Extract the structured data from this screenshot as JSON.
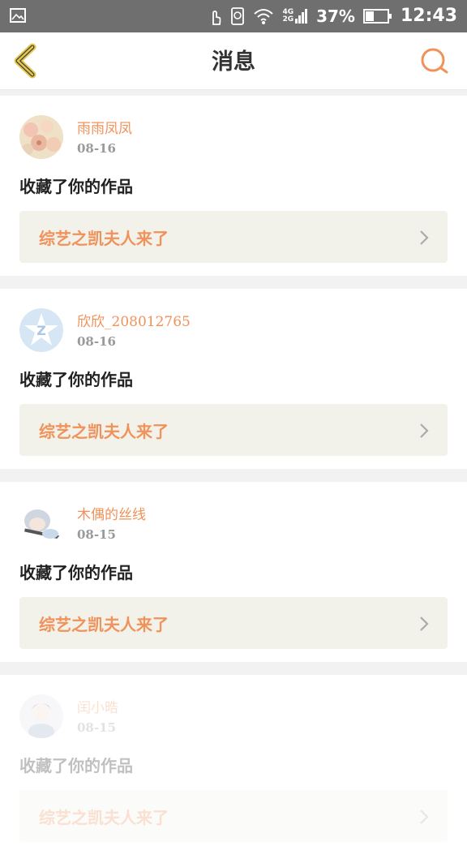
{
  "status_bar": {
    "network_top": "4G",
    "network_bottom": "2G",
    "battery_percent": "37%",
    "time": "12:43"
  },
  "nav": {
    "title": "消息",
    "back_icon": "chevron-left-icon",
    "search_icon": "search-icon",
    "accent_color": "#f0925a"
  },
  "messages": [
    {
      "username": "雨雨凤凤",
      "date": "08-16",
      "action": "收藏了你的作品",
      "work_title": "综艺之凯夫人来了",
      "avatar": "flower-avatar"
    },
    {
      "username": "欣欣_208012765",
      "date": "08-16",
      "action": "收藏了你的作品",
      "work_title": "综艺之凯夫人来了",
      "avatar": "default-z-avatar"
    },
    {
      "username": "木偶的丝线",
      "date": "08-15",
      "action": "收藏了你的作品",
      "work_title": "综艺之凯夫人来了",
      "avatar": "anime-avatar"
    },
    {
      "username": "闰小晧",
      "date": "08-15",
      "action": "收藏了你的作品",
      "work_title": "综艺之凯夫人来了",
      "avatar": "anime-avatar-2"
    }
  ]
}
